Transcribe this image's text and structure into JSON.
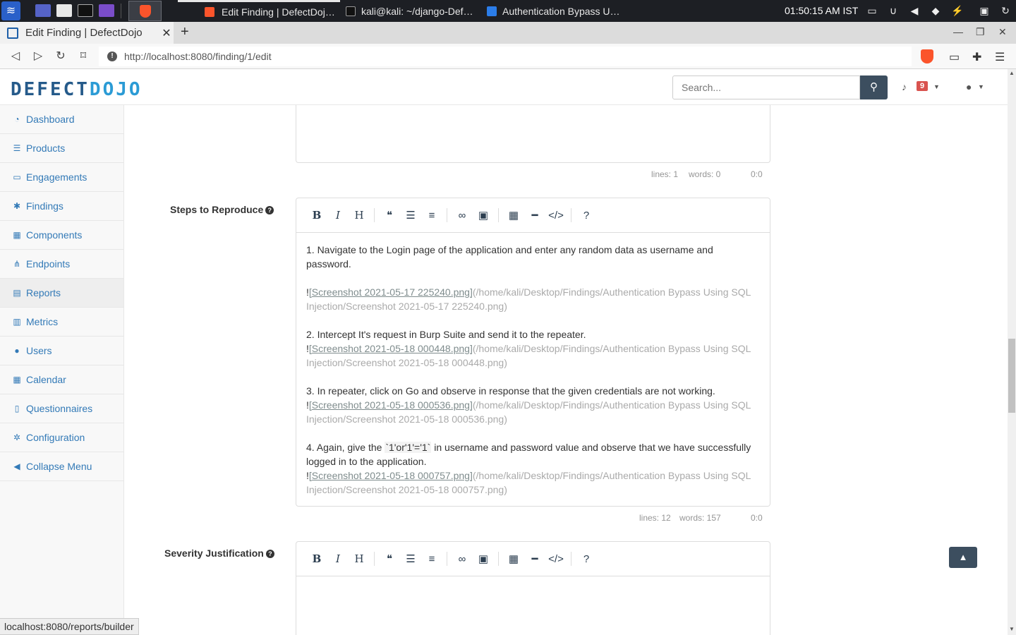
{
  "taskbar": {
    "tasks": [
      {
        "label": "Edit Finding | DefectDoj…",
        "active": true
      },
      {
        "label": "kali@kali: ~/django-Def…",
        "active": false
      },
      {
        "label": "Authentication Bypass U…",
        "active": false
      }
    ],
    "clock": "01:50:15 AM IST"
  },
  "browser": {
    "tab_title": "Edit Finding | DefectDojo",
    "url": "http://localhost:8080/finding/1/edit",
    "status_url": "localhost:8080/reports/builder"
  },
  "navbar": {
    "logo_left": "DEFECT",
    "logo_right": "DOJO",
    "search_placeholder": "Search...",
    "notification_count": "9"
  },
  "sidebar": {
    "items": [
      {
        "label": "Dashboard",
        "icon": "dashboard-icon",
        "glyph": "◔"
      },
      {
        "label": "Products",
        "icon": "list-icon",
        "glyph": "☰"
      },
      {
        "label": "Engagements",
        "icon": "inbox-icon",
        "glyph": "▭"
      },
      {
        "label": "Findings",
        "icon": "bug-icon",
        "glyph": "✱"
      },
      {
        "label": "Components",
        "icon": "grid-icon",
        "glyph": "▦"
      },
      {
        "label": "Endpoints",
        "icon": "sitemap-icon",
        "glyph": "⋔"
      },
      {
        "label": "Reports",
        "icon": "file-icon",
        "glyph": "▤"
      },
      {
        "label": "Metrics",
        "icon": "bar-chart-icon",
        "glyph": "▥"
      },
      {
        "label": "Users",
        "icon": "user-icon",
        "glyph": "●"
      },
      {
        "label": "Calendar",
        "icon": "calendar-icon",
        "glyph": "▦"
      },
      {
        "label": "Questionnaires",
        "icon": "clipboard-icon",
        "glyph": "▯"
      },
      {
        "label": "Configuration",
        "icon": "gear-icon",
        "glyph": "✲"
      },
      {
        "label": "Collapse Menu",
        "icon": "arrow-circle-left-icon",
        "glyph": "◀"
      }
    ]
  },
  "editor_above": {
    "lines": "lines: 1",
    "words": "words: 0",
    "cursor": "0:0"
  },
  "steps": {
    "label": "Steps to Reproduce",
    "lines": "lines: 12",
    "words": "words: 157",
    "cursor": "0:0",
    "p1": "1. Navigate to the Login page of the application and enter any random data as username and password.",
    "s1_alt": "[Screenshot 2021-05-17 225240.png]",
    "s1_path": "(/home/kali/Desktop/Findings/Authentication Bypass Using SQL Injection/Screenshot 2021-05-17 225240.png)",
    "p2": "2. Intercept It's request in Burp Suite and send it to the repeater.",
    "s2_alt": "[Screenshot 2021-05-18 000448.png]",
    "s2_path": "(/home/kali/Desktop/Findings/Authentication Bypass Using SQL Injection/Screenshot 2021-05-18 000448.png)",
    "p3": "3. In repeater, click on Go and observe in response that the given credentials are not working.",
    "s3_alt": "[Screenshot 2021-05-18 000536.png]",
    "s3_path": "(/home/kali/Desktop/Findings/Authentication Bypass Using SQL Injection/Screenshot 2021-05-18 000536.png)",
    "p4_pre": "4. Again, give the ",
    "p4_code": "`1'or'1'='1`",
    "p4_post": " in username and password value and observe that we have successfully logged in to the application.",
    "s4_alt": "[Screenshot 2021-05-18 000757.png]",
    "s4_path": "(/home/kali/Desktop/Findings/Authentication Bypass Using SQL Injection/Screenshot 2021-05-18 000757.png)"
  },
  "severity": {
    "label": "Severity Justification"
  },
  "glyphs": {
    "bang": "!"
  }
}
